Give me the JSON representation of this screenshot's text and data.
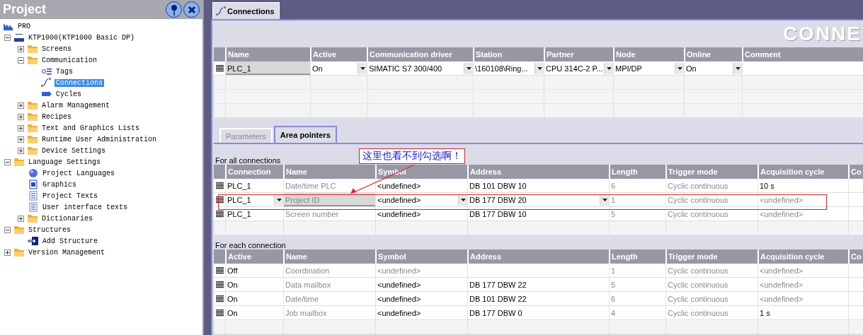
{
  "project_panel": {
    "title": "Project",
    "tree": [
      {
        "label": "PRO",
        "kind": "root",
        "selected": false,
        "children": [
          {
            "label": "KTP1000(KTP1000 Basic DP)",
            "kind": "device",
            "selected": false,
            "expanded": true,
            "children": [
              {
                "label": "Screens",
                "kind": "folder",
                "selected": false,
                "expanded": false
              },
              {
                "label": "Communication",
                "kind": "folder",
                "selected": false,
                "expanded": true,
                "children": [
                  {
                    "label": "Tags",
                    "kind": "tags",
                    "selected": false
                  },
                  {
                    "label": "Connections",
                    "kind": "link",
                    "selected": true
                  },
                  {
                    "label": "Cycles",
                    "kind": "cycles",
                    "selected": false
                  }
                ]
              },
              {
                "label": "Alarm Management",
                "kind": "folder",
                "selected": false,
                "expanded": false
              },
              {
                "label": "Recipes",
                "kind": "folder",
                "selected": false,
                "expanded": false
              },
              {
                "label": "Text and Graphics Lists",
                "kind": "folder",
                "selected": false,
                "expanded": false
              },
              {
                "label": "Runtime User Administration",
                "kind": "folder",
                "selected": false,
                "expanded": false
              },
              {
                "label": "Device Settings",
                "kind": "folder",
                "selected": false,
                "expanded": false
              }
            ]
          },
          {
            "label": "Language Settings",
            "kind": "folder",
            "selected": false,
            "expanded": true,
            "children": [
              {
                "label": "Project Languages",
                "kind": "globe",
                "selected": false
              },
              {
                "label": "Graphics",
                "kind": "graphic",
                "selected": false
              },
              {
                "label": "Project Texts",
                "kind": "text",
                "selected": false
              },
              {
                "label": "User interface texts",
                "kind": "text",
                "selected": false
              },
              {
                "label": "Dictionaries",
                "kind": "folder",
                "selected": false,
                "expanded": false
              }
            ]
          },
          {
            "label": "Structures",
            "kind": "folder",
            "selected": false,
            "expanded": true,
            "children": [
              {
                "label": "Add Structure",
                "kind": "add",
                "selected": false
              }
            ]
          },
          {
            "label": "Version Management",
            "kind": "folder",
            "selected": false,
            "expanded": false
          }
        ]
      }
    ]
  },
  "editor_tab": {
    "label": "Connections"
  },
  "heading": "CONNE",
  "connections_table": {
    "columns": [
      "Name",
      "Active",
      "Communication driver",
      "Station",
      "Partner",
      "Node",
      "Online",
      "Comment"
    ],
    "rows": [
      {
        "cells": [
          {
            "text": "PLC_1",
            "greyed": false,
            "focused": true,
            "dropdown": false
          },
          {
            "text": "On",
            "greyed": false,
            "focused": false,
            "dropdown": true
          },
          {
            "text": "SIMATIC S7 300/400",
            "greyed": false,
            "focused": false,
            "dropdown": true
          },
          {
            "text": "\\160108\\Ring...",
            "greyed": false,
            "focused": false,
            "dropdown": true
          },
          {
            "text": "CPU 314C-2 P...",
            "greyed": false,
            "focused": false,
            "dropdown": true
          },
          {
            "text": "MPI/DP",
            "greyed": false,
            "focused": false,
            "dropdown": true
          },
          {
            "text": "On",
            "greyed": false,
            "focused": false,
            "dropdown": true
          },
          {}
        ]
      }
    ]
  },
  "tabs": [
    {
      "label": "Parameters",
      "selected": false
    },
    {
      "label": "Area pointers",
      "selected": true
    }
  ],
  "for_all_connections": {
    "title": "For all connections",
    "columns": [
      "Connection",
      "Name",
      "Symbol",
      "Address",
      "Length",
      "Trigger mode",
      "Acquisition cycle",
      "Co"
    ],
    "rows": [
      {
        "annotated": false,
        "cells": [
          {
            "text": "PLC_1",
            "greyed": false,
            "focused": false,
            "dropdown": false
          },
          {
            "text": "Date/time PLC",
            "greyed": true,
            "focused": false,
            "dropdown": false
          },
          {
            "text": "<undefined>",
            "greyed": false,
            "focused": false,
            "dropdown": false
          },
          {
            "text": "DB 101 DBW 10",
            "greyed": false,
            "focused": false,
            "dropdown": false
          },
          {
            "text": "6",
            "greyed": true,
            "focused": false,
            "dropdown": false
          },
          {
            "text": "Cyclic continuous",
            "greyed": true,
            "focused": false,
            "dropdown": false
          },
          {
            "text": "10 s",
            "greyed": false,
            "focused": false,
            "dropdown": false
          },
          {}
        ]
      },
      {
        "annotated": true,
        "cells": [
          {
            "text": "PLC_1",
            "greyed": false,
            "focused": false,
            "dropdown": true
          },
          {
            "text": "Project ID",
            "greyed": true,
            "focused": true,
            "dropdown": false
          },
          {
            "text": "<undefined>",
            "greyed": false,
            "focused": false,
            "dropdown": true
          },
          {
            "text": "DB 177 DBW 20",
            "greyed": false,
            "focused": false,
            "dropdown": true
          },
          {
            "text": "1",
            "greyed": true,
            "focused": false,
            "dropdown": false
          },
          {
            "text": "Cyclic continuous",
            "greyed": true,
            "focused": false,
            "dropdown": false
          },
          {
            "text": "<undefined>",
            "greyed": true,
            "focused": false,
            "dropdown": false
          },
          {}
        ]
      },
      {
        "annotated": false,
        "cells": [
          {
            "text": "PLC_1",
            "greyed": false,
            "focused": false,
            "dropdown": false
          },
          {
            "text": "Screen number",
            "greyed": true,
            "focused": false,
            "dropdown": false
          },
          {
            "text": "<undefined>",
            "greyed": false,
            "focused": false,
            "dropdown": false
          },
          {
            "text": "DB 177 DBW 10",
            "greyed": false,
            "focused": false,
            "dropdown": false
          },
          {
            "text": "5",
            "greyed": true,
            "focused": false,
            "dropdown": false
          },
          {
            "text": "Cyclic continuous",
            "greyed": true,
            "focused": false,
            "dropdown": false
          },
          {
            "text": "<undefined>",
            "greyed": true,
            "focused": false,
            "dropdown": false
          },
          {}
        ]
      }
    ]
  },
  "annotation": {
    "text": "这里也看不到勾选啊！"
  },
  "for_each_connection": {
    "title": "For each connection",
    "columns": [
      "Active",
      "Name",
      "Symbol",
      "Address",
      "Length",
      "Trigger mode",
      "Acquisition cycle",
      "Co"
    ],
    "rows": [
      {
        "cells": [
          {
            "text": "Off",
            "greyed": false,
            "focused": false,
            "dropdown": false
          },
          {
            "text": "Coordination",
            "greyed": true,
            "focused": false,
            "dropdown": false
          },
          {
            "text": "<undefined>",
            "greyed": true,
            "focused": false,
            "dropdown": false
          },
          {},
          {
            "text": "1",
            "greyed": true,
            "focused": false,
            "dropdown": false
          },
          {
            "text": "Cyclic continuous",
            "greyed": true,
            "focused": false,
            "dropdown": false
          },
          {
            "text": "<undefined>",
            "greyed": true,
            "focused": false,
            "dropdown": false
          },
          {}
        ]
      },
      {
        "cells": [
          {
            "text": "On",
            "greyed": false,
            "focused": false,
            "dropdown": false
          },
          {
            "text": "Data mailbox",
            "greyed": true,
            "focused": false,
            "dropdown": false
          },
          {
            "text": "<undefined>",
            "greyed": false,
            "focused": false,
            "dropdown": false
          },
          {
            "text": "DB 177 DBW 22",
            "greyed": false,
            "focused": false,
            "dropdown": false
          },
          {
            "text": "5",
            "greyed": true,
            "focused": false,
            "dropdown": false
          },
          {
            "text": "Cyclic continuous",
            "greyed": true,
            "focused": false,
            "dropdown": false
          },
          {
            "text": "<undefined>",
            "greyed": true,
            "focused": false,
            "dropdown": false
          },
          {}
        ]
      },
      {
        "cells": [
          {
            "text": "On",
            "greyed": false,
            "focused": false,
            "dropdown": false
          },
          {
            "text": "Date/time",
            "greyed": true,
            "focused": false,
            "dropdown": false
          },
          {
            "text": "<undefined>",
            "greyed": false,
            "focused": false,
            "dropdown": false
          },
          {
            "text": "DB 101 DBW 22",
            "greyed": false,
            "focused": false,
            "dropdown": false
          },
          {
            "text": "6",
            "greyed": true,
            "focused": false,
            "dropdown": false
          },
          {
            "text": "Cyclic continuous",
            "greyed": true,
            "focused": false,
            "dropdown": false
          },
          {
            "text": "<undefined>",
            "greyed": true,
            "focused": false,
            "dropdown": false
          },
          {}
        ]
      },
      {
        "cells": [
          {
            "text": "On",
            "greyed": false,
            "focused": false,
            "dropdown": false
          },
          {
            "text": "Job mailbox",
            "greyed": true,
            "focused": false,
            "dropdown": false
          },
          {
            "text": "<undefined>",
            "greyed": false,
            "focused": false,
            "dropdown": false
          },
          {
            "text": "DB 177 DBW 0",
            "greyed": false,
            "focused": false,
            "dropdown": false
          },
          {
            "text": "4",
            "greyed": true,
            "focused": false,
            "dropdown": false
          },
          {
            "text": "Cyclic continuous",
            "greyed": true,
            "focused": false,
            "dropdown": false
          },
          {
            "text": "1 s",
            "greyed": false,
            "focused": false,
            "dropdown": false
          },
          {}
        ]
      }
    ]
  }
}
